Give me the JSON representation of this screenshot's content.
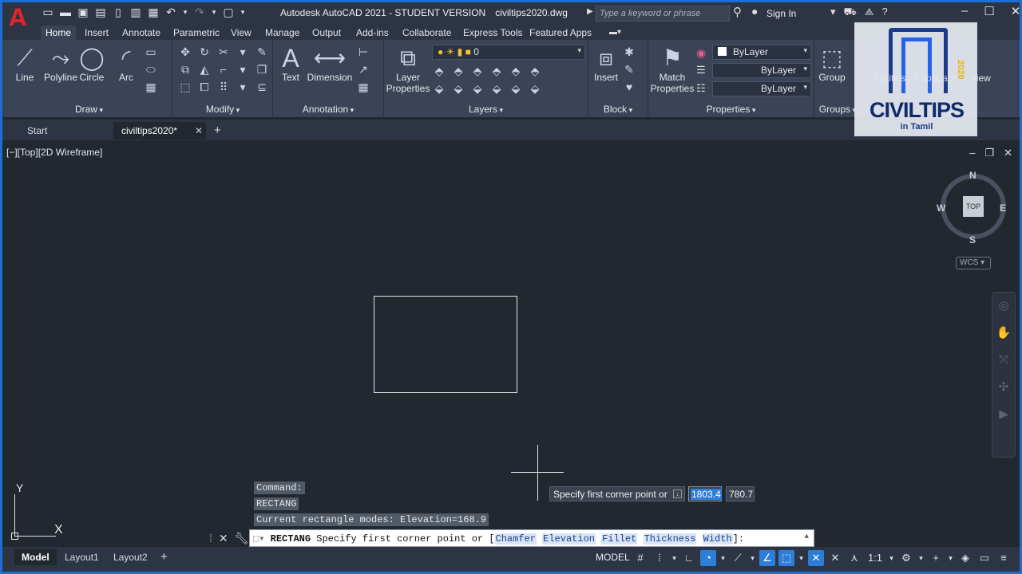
{
  "window": {
    "app_title": "Autodesk AutoCAD 2021 - STUDENT VERSION",
    "file_name": "civiltips2020.dwg",
    "app_logo": "A",
    "search_placeholder": "Type a keyword or phrase",
    "sign_in": "Sign In"
  },
  "ribbon_tabs": [
    "Home",
    "Insert",
    "Annotate",
    "Parametric",
    "View",
    "Manage",
    "Output",
    "Add-ins",
    "Collaborate",
    "Express Tools",
    "Featured Apps"
  ],
  "ribbon": {
    "draw": {
      "title": "Draw",
      "tools": [
        "Line",
        "Polyline",
        "Circle",
        "Arc"
      ]
    },
    "modify": {
      "title": "Modify"
    },
    "annotation": {
      "title": "Annotation",
      "tools": [
        "Text",
        "Dimension"
      ]
    },
    "layers": {
      "title": "Layers",
      "layer_properties_1": "Layer",
      "layer_properties_2": "Properties",
      "current_layer": "0"
    },
    "block": {
      "title": "Block",
      "insert": "Insert"
    },
    "properties": {
      "title": "Properties",
      "match_1": "Match",
      "match_2": "Properties",
      "color": "ByLayer",
      "linetype": "ByLayer",
      "lineweight": "ByLayer"
    },
    "groups": {
      "title": "Groups",
      "group": "Group"
    },
    "utilities": "Utilities",
    "clipboard": "Clipboard",
    "view": "View"
  },
  "watermark": {
    "brand": "CIVILTIPS",
    "tagline": "in Tamil",
    "year": "2020"
  },
  "file_tabs": {
    "start": "Start",
    "active": "civiltips2020*"
  },
  "viewport": {
    "label": "[−][Top][2D Wireframe]",
    "viewcube": {
      "top": "TOP",
      "n": "N",
      "s": "S",
      "w": "W",
      "e": "E",
      "wcs": "WCS"
    },
    "ucs": {
      "x": "X",
      "y": "Y"
    }
  },
  "dynamic_input": {
    "prompt": "Specify first corner point or",
    "x_value": "1803.4",
    "y_value": "780.7"
  },
  "command": {
    "history": [
      "Command:",
      "RECTANG",
      "Current rectangle modes:  Elevation=168.9"
    ],
    "name": "RECTANG",
    "prompt": "Specify first corner point or [",
    "options": [
      "Chamfer",
      "Elevation",
      "Fillet",
      "Thickness",
      "Width"
    ],
    "suffix": "]:"
  },
  "status": {
    "layout_tabs": [
      "Model",
      "Layout1",
      "Layout2"
    ],
    "space": "MODEL",
    "scale": "1:1"
  }
}
